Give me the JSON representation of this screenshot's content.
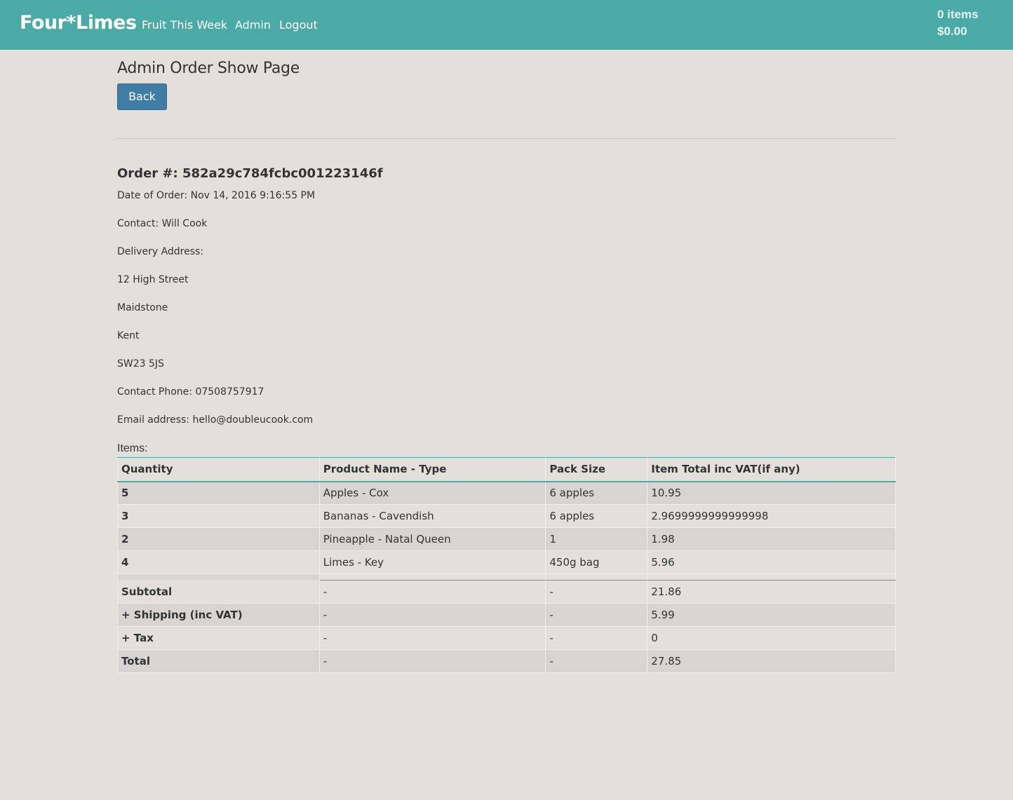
{
  "nav": {
    "brand": "Four*Limes",
    "links": [
      "Fruit This Week",
      "Admin",
      "Logout"
    ],
    "cart_items": "0 items",
    "cart_total": "$0.00"
  },
  "page": {
    "title": "Admin Order Show Page",
    "back_label": "Back"
  },
  "order": {
    "heading": "Order #: 582a29c784fcbc001223146f",
    "date": "Date of Order: Nov 14, 2016 9:16:55 PM",
    "contact": "Contact: Will Cook",
    "delivery_label": "Delivery Address:",
    "address_line1": "12 High Street",
    "address_city": "Maidstone",
    "address_county": "Kent",
    "address_postcode": "SW23 5JS",
    "phone": "Contact Phone: 07508757917",
    "email": "Email address: hello@doubleucook.com",
    "items_label": "Items:"
  },
  "table": {
    "headers": [
      "Quantity",
      "Product Name - Type",
      "Pack Size",
      "Item Total inc VAT(if any)"
    ],
    "rows": [
      [
        "5",
        "Apples - Cox",
        "6 apples",
        "10.95"
      ],
      [
        "3",
        "Bananas - Cavendish",
        "6 apples",
        "2.9699999999999998"
      ],
      [
        "2",
        "Pineapple - Natal Queen",
        "1",
        "1.98"
      ],
      [
        "4",
        "Limes - Key",
        "450g bag",
        "5.96"
      ]
    ],
    "summary": [
      [
        "Subtotal",
        "-",
        "-",
        "21.86"
      ],
      [
        "+ Shipping (inc VAT)",
        "-",
        "-",
        "5.99"
      ],
      [
        "+ Tax",
        "-",
        "-",
        "0"
      ],
      [
        "Total",
        "-",
        "-",
        "27.85"
      ]
    ]
  },
  "colors": {
    "navbar": "#4aaaa5",
    "page_bg": "#e3dfdb",
    "button": "#3f7da6"
  }
}
